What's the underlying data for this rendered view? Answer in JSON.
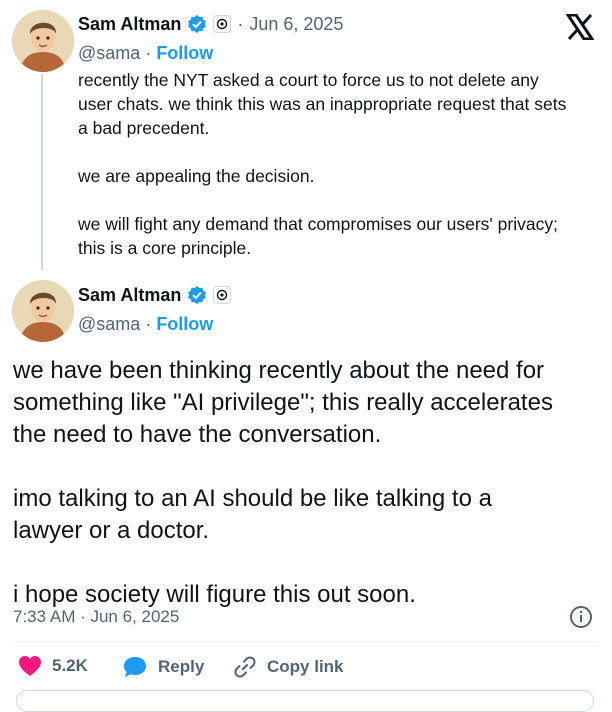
{
  "parent_post": {
    "author_name": "Sam Altman",
    "date": "Jun 6, 2025",
    "handle": "@sama",
    "follow_label": "Follow",
    "text": "recently the NYT asked a court to force us to not delete any\nuser chats. we think this was an inappropriate request that sets\na bad precedent.\n\nwe are appealing the decision.\n\nwe will fight any demand that compromises our users' privacy;\nthis is a core principle."
  },
  "main_post": {
    "author_name": "Sam Altman",
    "handle": "@sama",
    "follow_label": "Follow",
    "text": "we have been thinking recently about the need for\nsomething like \"AI privilege\"; this really accelerates\nthe need to have the conversation.\n\nimo talking to an AI should be like talking to a\nlawyer or a doctor.\n\ni hope society will figure this out soon.",
    "timestamp": "7:33 AM · Jun 6, 2025"
  },
  "actions": {
    "like_count": "5.2K",
    "reply_label": "Reply",
    "copy_link_label": "Copy link"
  },
  "colors": {
    "accent": "#1d9bf0",
    "like": "#f91880",
    "muted": "#536471"
  },
  "icons": [
    "x-logo-icon",
    "verified-badge-icon",
    "openai-badge-icon",
    "info-icon",
    "heart-icon",
    "reply-icon",
    "link-icon"
  ]
}
